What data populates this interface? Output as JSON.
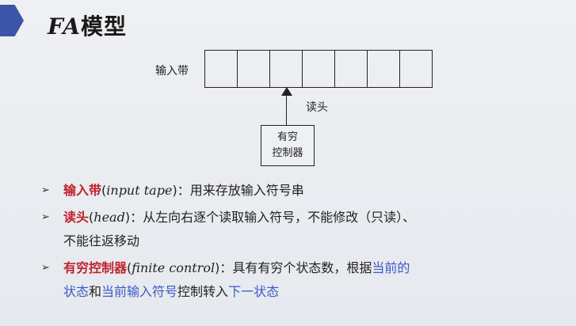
{
  "slide": {
    "title_prefix": "FA",
    "title_suffix": "模型"
  },
  "diagram": {
    "tape_label": "输入带",
    "tape_cells": 7,
    "head_label": "读头",
    "controller_line1": "有穷",
    "controller_line2": "控制器"
  },
  "bullets": [
    {
      "term": "输入带",
      "en": "input tape",
      "text": "：用来存放输入符号串"
    },
    {
      "term": "读头",
      "en": "head",
      "text": "：从左向右逐个读取输入符号，不能修改（只读）、",
      "text2": "不能往返移动"
    },
    {
      "term": "有穷控制器",
      "en": "finite control",
      "text": "：具有有穷个状态数，根据",
      "blue1": "当前的",
      "line2_blue1": "状态",
      "line2_mid": "和",
      "line2_blue2": "当前输入符号",
      "line2_mid2": "控制转入",
      "line2_blue3": "下一状态"
    }
  ],
  "colors": {
    "accent_red": "#c0232d",
    "accent_blue": "#3b59c8",
    "title_bar": "#3c55a8"
  }
}
